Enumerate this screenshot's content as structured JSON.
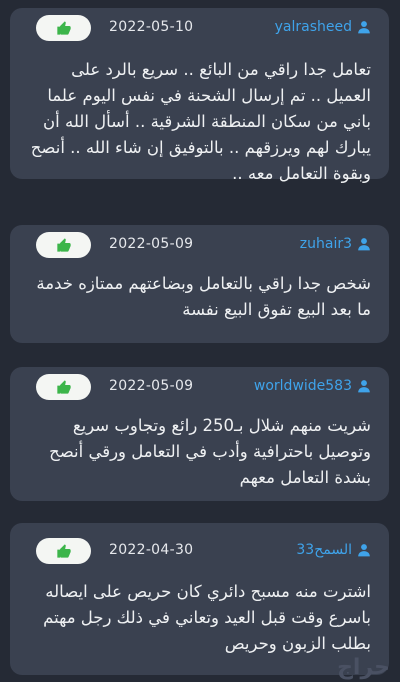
{
  "reviews": [
    {
      "username": "yalrasheed",
      "date": "2022-05-10",
      "text": "تعامل جدا راقي من البائع .. سريع بالرد على العميل .. تم إرسال الشحنة في نفس اليوم علما باني من سكان المنطقة الشرقية .. أسأل الله أن يبارك لهم ويرزقهم .. بالتوفيق إن شاء الله .. أنصح وبقوة التعامل معه .."
    },
    {
      "username": "zuhair3",
      "date": "2022-05-09",
      "text": "شخص جدا راقي بالتعامل وبضاعتهم ممتازه خدمة ما بعد البيع تفوق البيع نفسة"
    },
    {
      "username": "worldwide583",
      "date": "2022-05-09",
      "text": "شريت منهم شلال بـ250 رائع وتجاوب سريع وتوصيل باحترافية وأدب في التعامل ورقي أنصح بشدة التعامل معهم"
    },
    {
      "username": "السمح33",
      "date": "2022-04-30",
      "text": "اشترت منه مسبح دائري كان حريص على ايصاله باسرع وقت قبل العيد وتعاني في ذلك رجل مهتم بطلب الزبون وحريص"
    }
  ],
  "watermark": "حراج",
  "colors": {
    "background": "#252a35",
    "card": "#3a4150",
    "username": "#3fa3ea",
    "like_icon": "#3cb54a"
  },
  "icons": {
    "like": "thumbs-up-icon",
    "user": "user-icon"
  }
}
